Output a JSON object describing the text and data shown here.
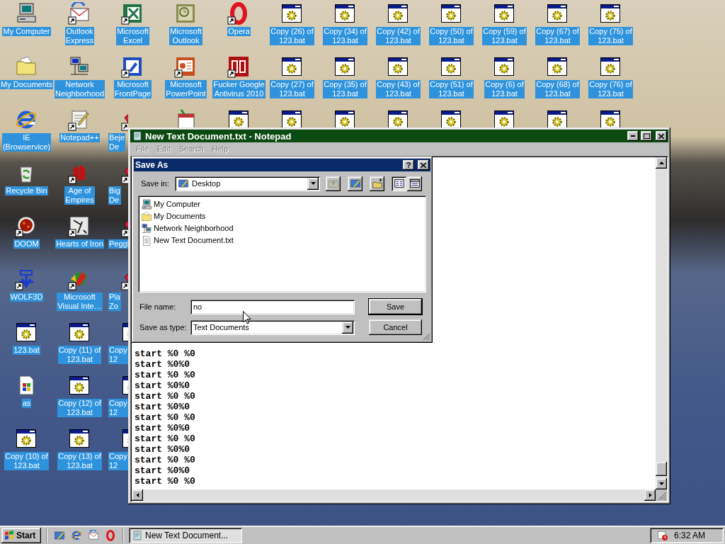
{
  "desktop": {
    "rows": [
      {
        "icons": [
          {
            "kind": "computer",
            "shortcut": false,
            "selected": true,
            "lines": [
              "My Computer"
            ]
          },
          {
            "kind": "mail",
            "shortcut": true,
            "selected": true,
            "lines": [
              "Outlook",
              "Express"
            ]
          },
          {
            "kind": "spreadsheet",
            "shortcut": true,
            "selected": true,
            "lines": [
              "Microsoft",
              "Excel"
            ]
          },
          {
            "kind": "clock",
            "shortcut": false,
            "selected": true,
            "lines": [
              "Microsoft",
              "Outlook"
            ]
          },
          {
            "kind": "ring",
            "shortcut": true,
            "selected": true,
            "lines": [
              "Opera"
            ]
          },
          {
            "kind": "batch",
            "shortcut": false,
            "selected": true,
            "lines": [
              "Copy (26) of",
              "123.bat"
            ]
          },
          {
            "kind": "batch",
            "shortcut": false,
            "selected": true,
            "lines": [
              "Copy (34) of",
              "123.bat"
            ]
          },
          {
            "kind": "batch",
            "shortcut": false,
            "selected": true,
            "lines": [
              "Copy (42) of",
              "123.bat"
            ]
          },
          {
            "kind": "batch",
            "shortcut": false,
            "selected": true,
            "lines": [
              "Copy (50) of",
              "123.bat"
            ]
          },
          {
            "kind": "batch",
            "shortcut": false,
            "selected": true,
            "lines": [
              "Copy (59) of",
              "123.bat"
            ]
          },
          {
            "kind": "batch",
            "shortcut": false,
            "selected": true,
            "lines": [
              "Copy (67) of",
              "123.bat"
            ]
          },
          {
            "kind": "batch",
            "shortcut": false,
            "selected": true,
            "lines": [
              "Copy (75) of",
              "123.bat"
            ]
          }
        ]
      },
      {
        "icons": [
          {
            "kind": "folder",
            "shortcut": false,
            "selected": true,
            "lines": [
              "My Documents"
            ]
          },
          {
            "kind": "network",
            "shortcut": false,
            "selected": true,
            "lines": [
              "Network",
              "Neighborhood"
            ]
          },
          {
            "kind": "frontpage",
            "shortcut": true,
            "selected": true,
            "lines": [
              "Microsoft",
              "FrontPage"
            ]
          },
          {
            "kind": "powerpoint",
            "shortcut": true,
            "selected": true,
            "lines": [
              "Microsoft",
              "PowerPoint"
            ]
          },
          {
            "kind": "fg",
            "shortcut": true,
            "selected": true,
            "lines": [
              "Fucker Google",
              "Antivirus 2010"
            ]
          },
          {
            "kind": "batch",
            "shortcut": false,
            "selected": true,
            "lines": [
              "Copy (27) of",
              "123.bat"
            ]
          },
          {
            "kind": "batch",
            "shortcut": false,
            "selected": true,
            "lines": [
              "Copy (35) of",
              "123.bat"
            ]
          },
          {
            "kind": "batch",
            "shortcut": false,
            "selected": true,
            "lines": [
              "Copy (43) of",
              "123.bat"
            ]
          },
          {
            "kind": "batch",
            "shortcut": false,
            "selected": true,
            "lines": [
              "Copy (51) of",
              "123.bat"
            ]
          },
          {
            "kind": "batch",
            "shortcut": false,
            "selected": true,
            "lines": [
              "Copy (6) of",
              "123.bat"
            ]
          },
          {
            "kind": "batch",
            "shortcut": false,
            "selected": true,
            "lines": [
              "Copy (68) of",
              "123.bat"
            ]
          },
          {
            "kind": "batch",
            "shortcut": false,
            "selected": true,
            "lines": [
              "Copy (76) of",
              "123.bat"
            ]
          }
        ]
      },
      {
        "icons": [
          {
            "kind": "ie",
            "shortcut": false,
            "selected": true,
            "lines": [
              "IE",
              "(Browservice)"
            ]
          },
          {
            "kind": "notepad",
            "shortcut": true,
            "selected": true,
            "lines": [
              "Notepad++"
            ]
          },
          {
            "kind": "gem",
            "shortcut": true,
            "covered": true,
            "selected": true,
            "lines": [
              "Beje",
              "De"
            ]
          },
          {
            "kind": "calendar",
            "shortcut": false,
            "cut_off": true
          },
          {
            "kind": "batch",
            "shortcut": false,
            "cut_off": true
          },
          {
            "kind": "batch",
            "shortcut": false,
            "cut_off": true
          },
          {
            "kind": "batch",
            "shortcut": false,
            "cut_off": true
          },
          {
            "kind": "batch",
            "shortcut": false,
            "cut_off": true
          },
          {
            "kind": "batch",
            "shortcut": false,
            "cut_off": true
          },
          {
            "kind": "batch",
            "shortcut": false,
            "cut_off": true
          },
          {
            "kind": "batch",
            "shortcut": false,
            "cut_off": true
          },
          {
            "kind": "batch",
            "shortcut": false,
            "cut_off": true
          }
        ]
      },
      {
        "icons": [
          {
            "kind": "recycle",
            "shortcut": false,
            "selected": true,
            "lines": [
              "Recycle Bin"
            ]
          },
          {
            "kind": "game",
            "shortcut": true,
            "selected": true,
            "lines": [
              "Age of",
              "Empires"
            ]
          },
          {
            "kind": "gem",
            "shortcut": true,
            "covered": true,
            "selected": true,
            "lines": [
              "Big",
              "De"
            ]
          }
        ]
      },
      {
        "icons": [
          {
            "kind": "doom",
            "shortcut": true,
            "selected": true,
            "lines": [
              "DOOM"
            ]
          },
          {
            "kind": "hoi",
            "shortcut": true,
            "selected": true,
            "lines": [
              "Hearts of Iron"
            ]
          },
          {
            "kind": "gem",
            "shortcut": true,
            "covered": true,
            "selected": true,
            "lines": [
              "Peggl"
            ]
          }
        ]
      },
      {
        "icons": [
          {
            "kind": "wolf",
            "shortcut": true,
            "selected": true,
            "lines": [
              "WOLF3D"
            ]
          },
          {
            "kind": "vi",
            "shortcut": true,
            "selected": true,
            "lines": [
              "Microsoft",
              "Visual Inte…"
            ]
          },
          {
            "kind": "gem",
            "shortcut": true,
            "covered": true,
            "selected": true,
            "lines": [
              "Pla",
              "Zo"
            ]
          }
        ]
      },
      {
        "icons": [
          {
            "kind": "batch",
            "shortcut": false,
            "selected": true,
            "lines": [
              "123.bat"
            ]
          },
          {
            "kind": "batch",
            "shortcut": false,
            "selected": true,
            "lines": [
              "Copy (11) of",
              "123.bat"
            ]
          },
          {
            "kind": "batch",
            "shortcut": false,
            "covered": true,
            "selected": true,
            "lines": [
              "Copy",
              "12"
            ]
          }
        ]
      },
      {
        "icons": [
          {
            "kind": "doc",
            "shortcut": false,
            "selected": true,
            "lines": [
              "as"
            ]
          },
          {
            "kind": "batch",
            "shortcut": false,
            "selected": true,
            "lines": [
              "Copy (12) of",
              "123.bat"
            ]
          },
          {
            "kind": "batch",
            "shortcut": false,
            "covered": true,
            "selected": true,
            "lines": [
              "Copy",
              "12"
            ]
          }
        ]
      },
      {
        "icons": [
          {
            "kind": "batch",
            "shortcut": false,
            "selected": true,
            "lines": [
              "Copy (10) of",
              "123.bat"
            ]
          },
          {
            "kind": "batch",
            "shortcut": false,
            "selected": true,
            "lines": [
              "Copy (13) of",
              "123.bat"
            ]
          },
          {
            "kind": "batch",
            "shortcut": false,
            "covered": true,
            "selected": true,
            "lines": [
              "Copy",
              "12"
            ]
          }
        ]
      }
    ]
  },
  "notepad": {
    "title": "New Text Document.txt - Notepad",
    "menu": [
      {
        "label": "File",
        "disabled": true
      },
      {
        "label": "Edit",
        "disabled": true
      },
      {
        "label": "Search",
        "disabled": true
      },
      {
        "label": "Help",
        "disabled": true
      }
    ],
    "lines": [
      "start %0 %0",
      "start %0%0",
      "start %0 %0",
      "start %0%0",
      "start %0 %0",
      "start %0%0",
      "start %0 %0",
      "start %0%0",
      "start %0 %0",
      "start %0%0",
      "start %0 %0",
      "start %0%0",
      "start %0 %0"
    ]
  },
  "save_dialog": {
    "title": "Save As",
    "help": "?",
    "save_in": {
      "label": "Save in:",
      "value": "Desktop"
    },
    "toolbar": [
      {
        "kind": "up",
        "disabled": true,
        "selected": false
      },
      {
        "kind": "desktop",
        "disabled": false,
        "selected": false
      },
      {
        "kind": "newfolder",
        "disabled": false,
        "selected": false
      },
      {
        "kind": "list",
        "disabled": false,
        "selected": true
      },
      {
        "kind": "details",
        "disabled": false,
        "selected": false
      }
    ],
    "files": [
      {
        "kind": "computer",
        "name": "My Computer"
      },
      {
        "kind": "folder",
        "name": "My Documents"
      },
      {
        "kind": "network",
        "name": "Network Neighborhood"
      },
      {
        "kind": "text",
        "name": "New Text Document.txt"
      }
    ],
    "file_name": {
      "label": "File name:",
      "value": "no"
    },
    "save_as_type": {
      "label": "Save as type:",
      "value": "Text Documents"
    },
    "buttons": [
      {
        "label": "Save",
        "default": true
      },
      {
        "label": "Cancel",
        "default": false
      }
    ]
  },
  "taskbar": {
    "start": "Start",
    "quick_launch": [
      {
        "kind": "desktop"
      },
      {
        "kind": "ie"
      },
      {
        "kind": "mail"
      },
      {
        "kind": "ring"
      }
    ],
    "tasks": [
      {
        "label": "New Text Document...",
        "selected": true
      }
    ],
    "clock": "6:32 AM"
  }
}
